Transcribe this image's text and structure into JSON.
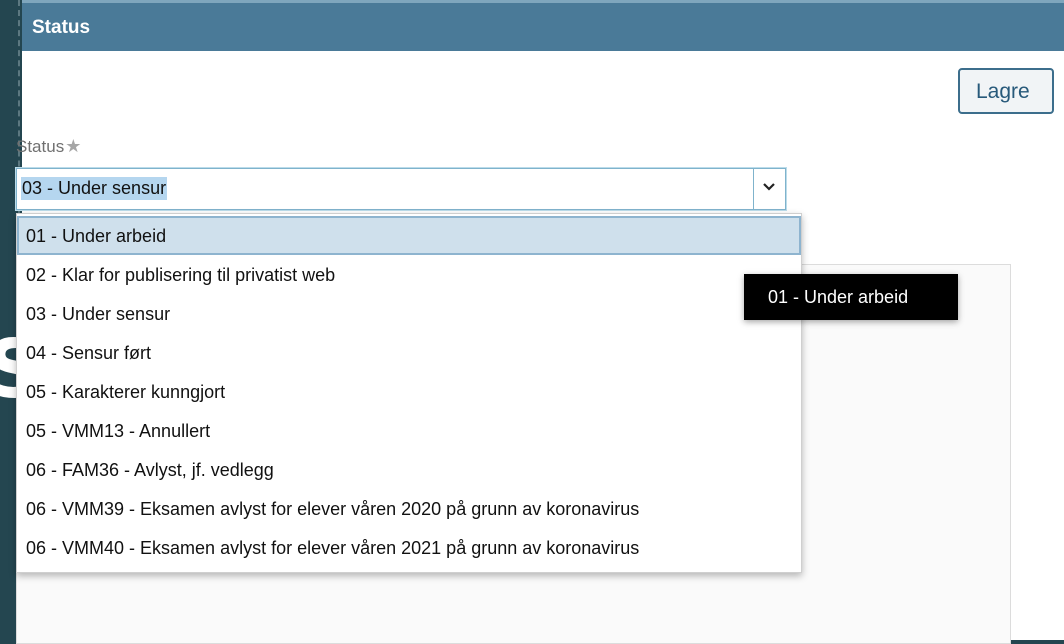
{
  "dialog": {
    "title": "Status",
    "close_icon": "close-icon",
    "save_label": "Lagre"
  },
  "status_field": {
    "label": "Status",
    "required_marker": "★",
    "selected_value": "03 - Under sensur",
    "options": [
      "01 - Under arbeid",
      "02 - Klar for publisering til privatist web",
      "03 - Under sensur",
      "04 - Sensur ført",
      "05 - Karakterer kunngjort",
      "05 - VMM13 - Annullert",
      "06 - FAM36 - Avlyst, jf. vedlegg",
      "06 - VMM39 - Eksamen avlyst for elever våren 2020 på grunn av koronavirus",
      "06 - VMM40 - Eksamen avlyst for elever våren 2021 på grunn av koronavirus"
    ],
    "highlighted_index": 0
  },
  "tooltip": {
    "text": "01 - Under arbeid"
  },
  "colors": {
    "header_bg": "#4a7a98",
    "page_bg": "#244650",
    "accent_border": "#3c6e8c",
    "selection_bg": "#cfe0ec"
  }
}
